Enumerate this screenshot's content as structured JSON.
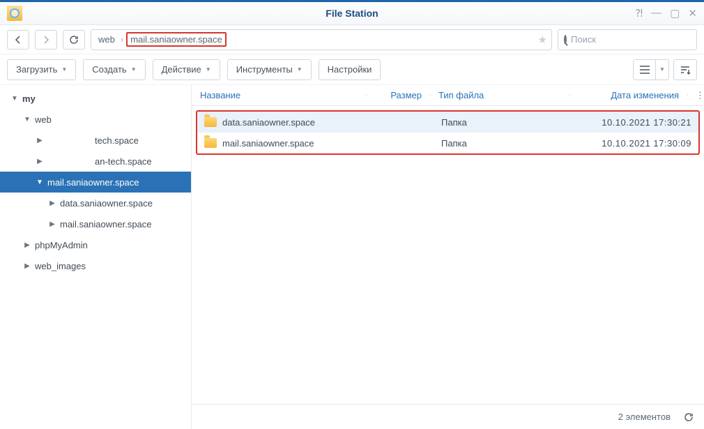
{
  "app_title": "File Station",
  "path": {
    "segments": [
      "web",
      "mail.saniaowner.space"
    ],
    "highlight_index": 1
  },
  "search": {
    "placeholder": "Поиск"
  },
  "toolbar": {
    "upload": "Загрузить",
    "create": "Создать",
    "action": "Действие",
    "tools": "Инструменты",
    "settings": "Настройки"
  },
  "tree": [
    {
      "label": "my",
      "depth": 0,
      "expanded": true
    },
    {
      "label": "web",
      "depth": 1,
      "expanded": true
    },
    {
      "label": "tech.space",
      "depth": 2,
      "expanded": false,
      "hasChildren": true
    },
    {
      "label": "an-tech.space",
      "depth": 2,
      "expanded": false,
      "hasChildren": true
    },
    {
      "label": "mail.saniaowner.space",
      "depth": "2b",
      "expanded": true,
      "selected": true
    },
    {
      "label": "data.saniaowner.space",
      "depth": 3,
      "expanded": false,
      "hasChildren": true
    },
    {
      "label": "mail.saniaowner.space",
      "depth": 3,
      "expanded": false,
      "hasChildren": true
    },
    {
      "label": "phpMyAdmin",
      "depth": 1,
      "expanded": false,
      "hasChildren": true
    },
    {
      "label": "web_images",
      "depth": 1,
      "expanded": false,
      "hasChildren": true
    }
  ],
  "columns": {
    "name": "Название",
    "size": "Размер",
    "type": "Тип файла",
    "date": "Дата изменения"
  },
  "rows": [
    {
      "name": "data.saniaowner.space",
      "size": "",
      "type": "Папка",
      "date": "10.10.2021 17:30:21",
      "selected": true
    },
    {
      "name": "mail.saniaowner.space",
      "size": "",
      "type": "Папка",
      "date": "10.10.2021 17:30:09",
      "selected": false
    }
  ],
  "status": {
    "count_label": "2 элементов"
  }
}
